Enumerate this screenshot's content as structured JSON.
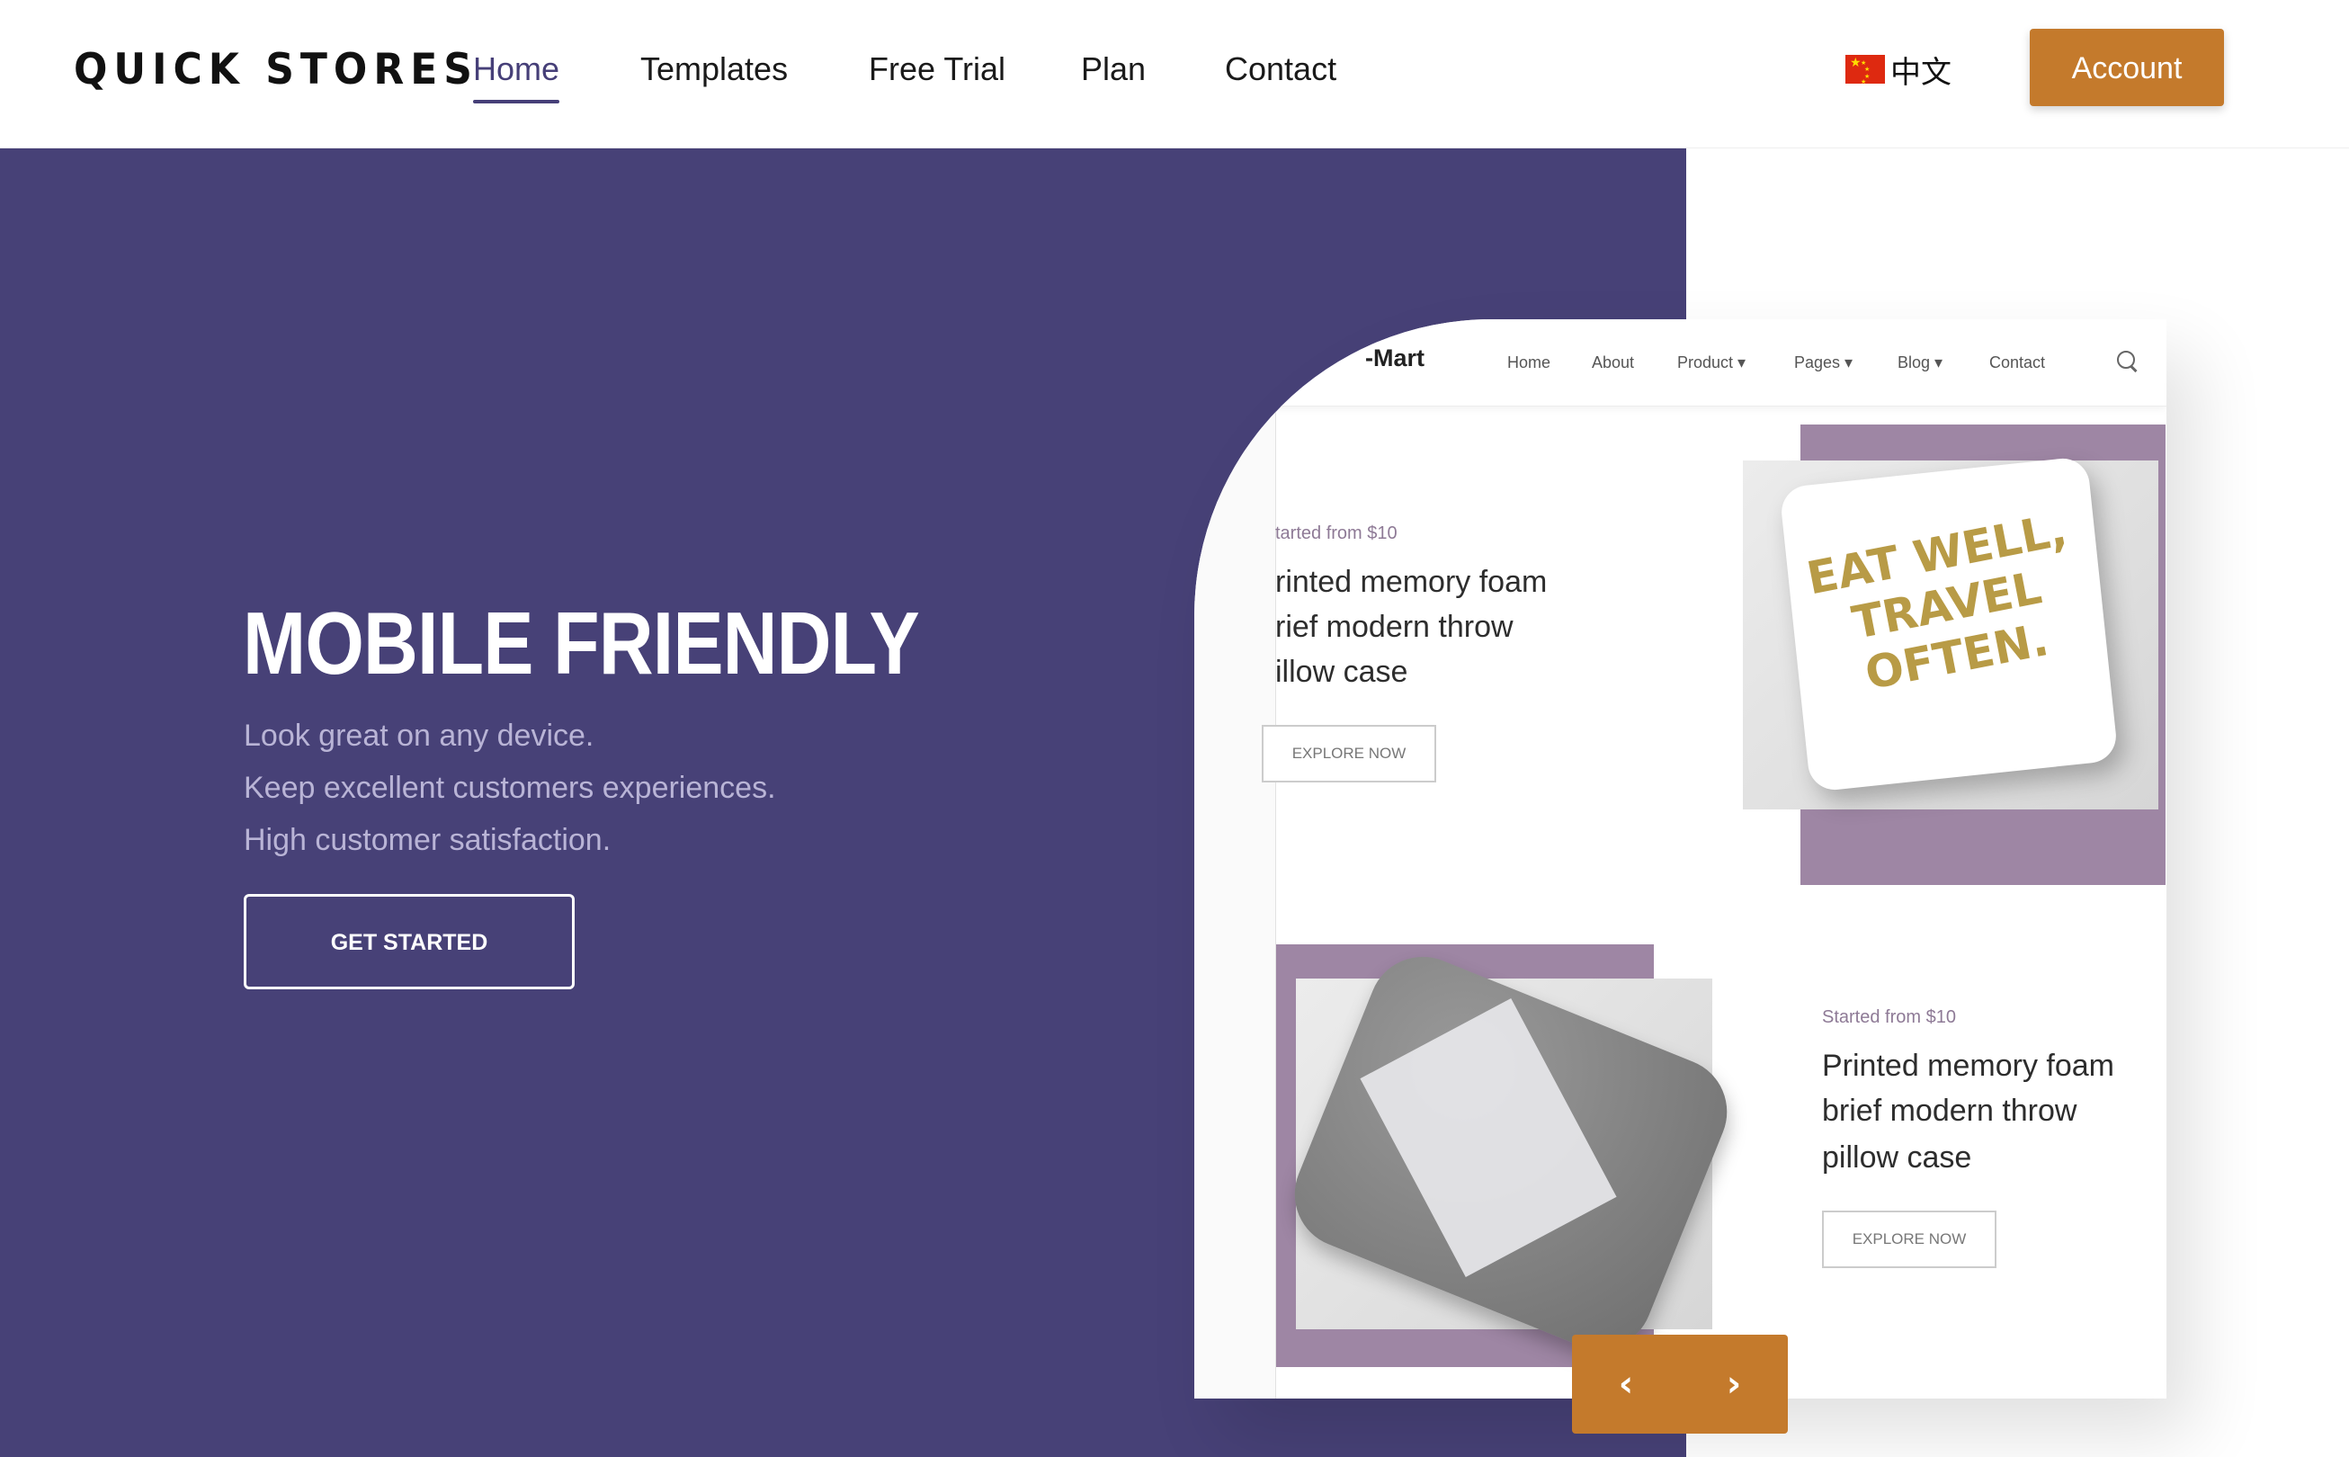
{
  "header": {
    "brand": "QUICK STORES",
    "nav": [
      {
        "label": "Home",
        "active": true
      },
      {
        "label": "Templates"
      },
      {
        "label": "Free Trial"
      },
      {
        "label": "Plan"
      },
      {
        "label": "Contact"
      }
    ],
    "language": {
      "flag": "china-flag-icon",
      "label": "中文"
    },
    "account_label": "Account"
  },
  "hero": {
    "headline": "MOBILE FRIENDLY",
    "lines": [
      "Look great on any device.",
      "Keep excellent customers experiences.",
      "High customer satisfaction."
    ],
    "cta_label": "GET STARTED"
  },
  "mockup": {
    "logo": "-Mart",
    "nav": [
      "Home",
      "About",
      "Product ▾",
      "Pages ▾",
      "Blog ▾",
      "Contact"
    ],
    "search_icon": "search-icon",
    "products": [
      {
        "tag": "tarted from $10",
        "title_lines": [
          "rinted memory foam",
          "rief modern throw",
          "illow case"
        ],
        "button": "EXPLORE NOW",
        "image_text": "EAT WELL, TRAVEL OFTEN."
      },
      {
        "tag": "Started from $10",
        "title_lines": [
          "Printed memory foam",
          "brief modern throw",
          "pillow case"
        ],
        "button": "EXPLORE NOW"
      }
    ]
  },
  "slider": {
    "prev_icon": "chevron-left-icon",
    "next_icon": "chevron-right-icon",
    "prev": "‹",
    "next": "›"
  },
  "colors": {
    "hero_bg": "#474177",
    "accent": "#c47a2c",
    "mock_purple": "#9e86a4"
  }
}
